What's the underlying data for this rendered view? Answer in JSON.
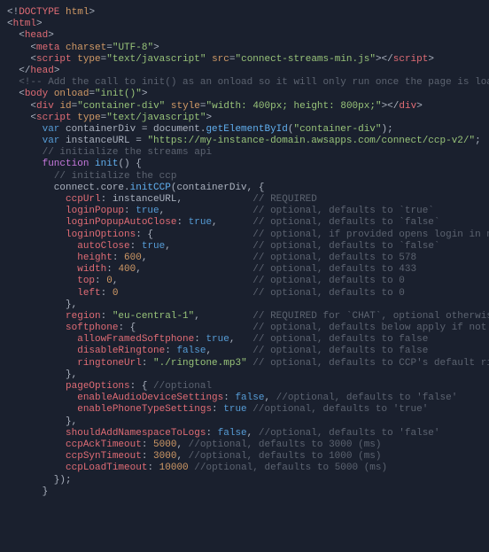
{
  "code": "<span class='lt'>&lt;!</span><span class='tag'>DOCTYPE</span> <span class='attr'>html</span><span class='lt'>&gt;</span>\n<span class='lt'>&lt;</span><span class='tag'>html</span><span class='lt'>&gt;</span>\n  <span class='lt'>&lt;</span><span class='tag'>head</span><span class='lt'>&gt;</span>\n    <span class='lt'>&lt;</span><span class='tag'>meta</span> <span class='attr'>charset</span>=<span class='str'>\"UTF-8\"</span><span class='lt'>&gt;</span>\n    <span class='lt'>&lt;</span><span class='tag'>script</span> <span class='attr'>type</span>=<span class='str'>\"text/javascript\"</span> <span class='attr'>src</span>=<span class='str'>\"connect-streams-min.js\"</span><span class='lt'>&gt;&lt;/</span><span class='tag'>script</span><span class='lt'>&gt;</span>\n  <span class='lt'>&lt;/</span><span class='tag'>head</span><span class='lt'>&gt;</span>\n  <span class='cmt'>&lt;!-- Add the call to init() as an onload so it will only run once the page is loaded --&gt;</span>\n  <span class='lt'>&lt;</span><span class='tag'>body</span> <span class='attr'>onload</span>=<span class='str'>\"init()\"</span><span class='lt'>&gt;</span>\n    <span class='lt'>&lt;</span><span class='tag'>div</span> <span class='attr'>id</span>=<span class='str'>\"container-div\"</span> <span class='attr'>style</span>=<span class='str'>\"width: 400px; height: 800px;\"</span><span class='lt'>&gt;&lt;/</span><span class='tag'>div</span><span class='lt'>&gt;</span>\n    <span class='lt'>&lt;</span><span class='tag'>script</span> <span class='attr'>type</span>=<span class='str'>\"text/javascript\"</span><span class='lt'>&gt;</span>\n      <span class='var'>var</span> containerDiv = document.<span class='fn'>getElementById</span>(<span class='str'>\"container-div\"</span>);\n      <span class='var'>var</span> instanceURL = <span class='str'>\"https://my-instance-domain.awsapps.com/connect/ccp-v2/\"</span>;\n      <span class='cmt'>// initialize the streams api</span>\n      <span class='kw'>function</span> <span class='fn'>init</span>() {\n        <span class='cmt'>// initialize the ccp</span>\n        connect.core.<span class='fn'>initCCP</span>(containerDiv, {\n          <span class='prop'>ccpUrl</span>: instanceURL,            <span class='cmt'>// REQUIRED</span>\n          <span class='prop'>loginPopup</span>: <span class='bool'>true</span>,               <span class='cmt'>// optional, defaults to `true`</span>\n          <span class='prop'>loginPopupAutoClose</span>: <span class='bool'>true</span>,      <span class='cmt'>// optional, defaults to `false`</span>\n          <span class='prop'>loginOptions</span>: {                 <span class='cmt'>// optional, if provided opens login in new window</span>\n            <span class='prop'>autoClose</span>: <span class='bool'>true</span>,              <span class='cmt'>// optional, defaults to `false`</span>\n            <span class='prop'>height</span>: <span class='num'>600</span>,                  <span class='cmt'>// optional, defaults to 578</span>\n            <span class='prop'>width</span>: <span class='num'>400</span>,                   <span class='cmt'>// optional, defaults to 433</span>\n            <span class='prop'>top</span>: <span class='num'>0</span>,                       <span class='cmt'>// optional, defaults to 0</span>\n            <span class='prop'>left</span>: <span class='num'>0</span>                       <span class='cmt'>// optional, defaults to 0</span>\n          },\n          <span class='prop'>region</span>: <span class='str'>\"eu-central-1\"</span>,         <span class='cmt'>// REQUIRED for `CHAT`, optional otherwise</span>\n          <span class='prop'>softphone</span>: {                    <span class='cmt'>// optional, defaults below apply if not provided</span>\n            <span class='prop'>allowFramedSoftphone</span>: <span class='bool'>true</span>,   <span class='cmt'>// optional, defaults to false</span>\n            <span class='prop'>disableRingtone</span>: <span class='bool'>false</span>,       <span class='cmt'>// optional, defaults to false</span>\n            <span class='prop'>ringtoneUrl</span>: <span class='str'>\"./ringtone.mp3\"</span> <span class='cmt'>// optional, defaults to CCP's default ringtone if a falsy value is s</span>\n          },\n          <span class='prop'>pageOptions</span>: { <span class='cmt'>//optional</span>\n            <span class='prop'>enableAudioDeviceSettings</span>: <span class='bool'>false</span>, <span class='cmt'>//optional, defaults to 'false'</span>\n            <span class='prop'>enablePhoneTypeSettings</span>: <span class='bool'>true</span> <span class='cmt'>//optional, defaults to 'true'</span>\n          },\n          <span class='prop'>shouldAddNamespaceToLogs</span>: <span class='bool'>false</span>, <span class='cmt'>//optional, defaults to 'false'</span>\n          <span class='prop'>ccpAckTimeout</span>: <span class='num'>5000</span>, <span class='cmt'>//optional, defaults to 3000 (ms)</span>\n          <span class='prop'>ccpSynTimeout</span>: <span class='num'>3000</span>, <span class='cmt'>//optional, defaults to 1000 (ms)</span>\n          <span class='prop'>ccpLoadTimeout</span>: <span class='num'>10000</span> <span class='cmt'>//optional, defaults to 5000 (ms)</span>\n        });\n      }"
}
